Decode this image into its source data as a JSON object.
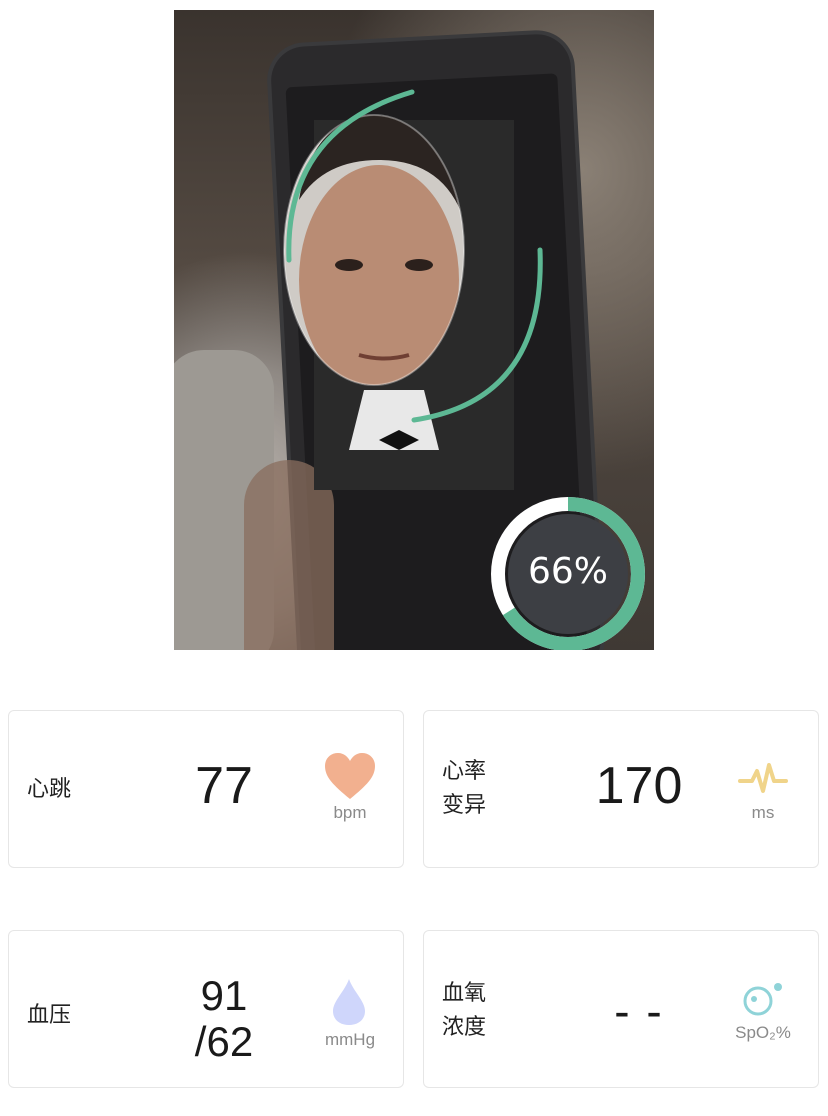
{
  "scan": {
    "progress_percent": 66,
    "progress_label": "66%",
    "ring_color": "#5db894",
    "face_guide_color": "#5db894"
  },
  "metrics": [
    {
      "key": "heart_rate",
      "label_lines": [
        "心跳"
      ],
      "value_lines": [
        "77"
      ],
      "unit": "bpm",
      "icon": "heart-icon",
      "icon_color": "#f2b08f"
    },
    {
      "key": "hrv",
      "label_lines": [
        "心率",
        "变异"
      ],
      "value_lines": [
        "170"
      ],
      "unit": "ms",
      "icon": "pulse-icon",
      "icon_color": "#f0d48a"
    },
    {
      "key": "blood_pressure",
      "label_lines": [
        "血压"
      ],
      "value_lines": [
        "91",
        "/62"
      ],
      "unit": "mmHg",
      "icon": "water-drop-icon",
      "icon_color": "#cfd6fb"
    },
    {
      "key": "blood_oxygen",
      "label_lines": [
        "血氧",
        "浓度"
      ],
      "value_lines": [
        "- -"
      ],
      "unit": "SpO₂%",
      "icon": "bubbles-icon",
      "icon_color": "#8fd3d8"
    }
  ]
}
